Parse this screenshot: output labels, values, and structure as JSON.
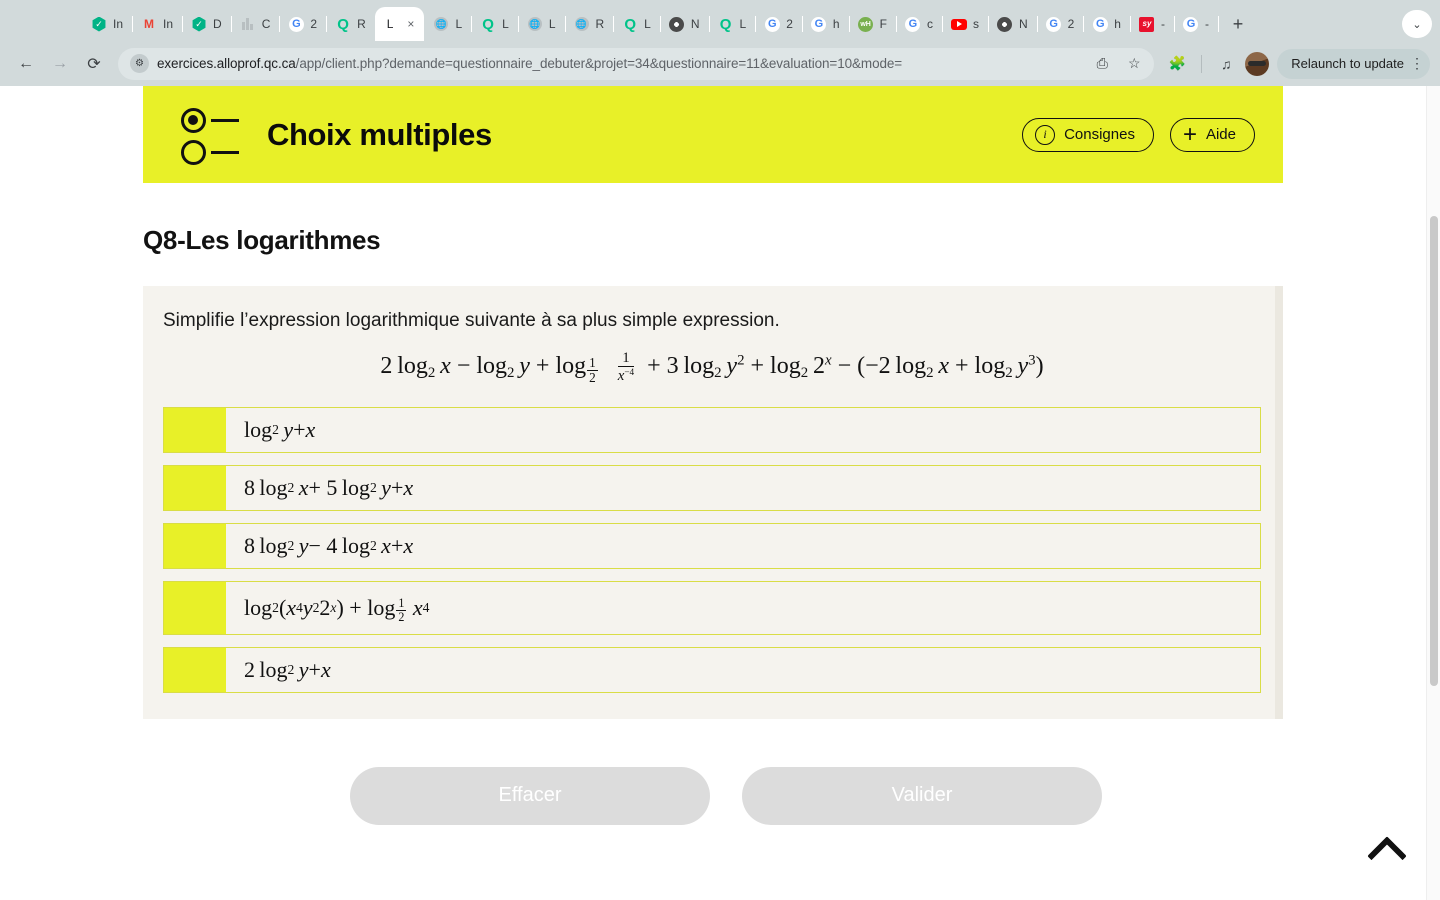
{
  "browser": {
    "tabs": [
      {
        "title": "In",
        "icon": "hexagon-green-icon",
        "active": false
      },
      {
        "title": "In",
        "icon": "gmail-icon",
        "active": false
      },
      {
        "title": "D",
        "icon": "hexagon-green-icon",
        "active": false
      },
      {
        "title": "C",
        "icon": "bars-grey-icon",
        "active": false
      },
      {
        "title": "2",
        "icon": "google-icon",
        "active": false
      },
      {
        "title": "R",
        "icon": "quizlet-icon",
        "active": false
      },
      {
        "title": "L",
        "icon": "alloprof-icon",
        "active": true
      },
      {
        "title": "L",
        "icon": "globe-grey-icon",
        "active": false
      },
      {
        "title": "L",
        "icon": "quizlet-icon",
        "active": false
      },
      {
        "title": "L",
        "icon": "globe-grey-icon",
        "active": false
      },
      {
        "title": "R",
        "icon": "globe-grey-icon",
        "active": false
      },
      {
        "title": "L",
        "icon": "quizlet-icon",
        "active": false
      },
      {
        "title": "N",
        "icon": "chrome-dark-icon",
        "active": false
      },
      {
        "title": "L",
        "icon": "quizlet-icon",
        "active": false
      },
      {
        "title": "2",
        "icon": "google-icon",
        "active": false
      },
      {
        "title": "h",
        "icon": "google-icon",
        "active": false
      },
      {
        "title": "F",
        "icon": "whatsapp-green-icon",
        "active": false
      },
      {
        "title": "c",
        "icon": "google-icon",
        "active": false
      },
      {
        "title": "s",
        "icon": "youtube-icon",
        "active": false
      },
      {
        "title": "N",
        "icon": "chrome-dark-icon",
        "active": false
      },
      {
        "title": "2",
        "icon": "google-icon",
        "active": false
      },
      {
        "title": "h",
        "icon": "google-icon",
        "active": false
      },
      {
        "title": "-",
        "icon": "sy-red-icon",
        "active": false
      },
      {
        "title": "-",
        "icon": "google-icon",
        "active": false
      }
    ],
    "new_tab_label": "+",
    "tab_close_label": "×",
    "tab_search_label": "⌄",
    "nav": {
      "back": "←",
      "forward": "→",
      "reload": "⟳"
    },
    "omnibox": {
      "site_info_icon": "site-settings-icon",
      "url_host": "exercices.alloprof.qc.ca",
      "url_path": "/app/client.php?demande=questionnaire_debuter&projet=34&questionnaire=11&evaluation=10&mode=",
      "translate_icon": "translate-icon",
      "bookmark_icon": "star-icon"
    },
    "extensions_icon": "extensions-puzzle-icon",
    "media_icon": "media-list-icon",
    "profile_icon": "profile-avatar",
    "relaunch_label": "Relaunch to update",
    "menu_icon": "kebab-menu-icon"
  },
  "banner": {
    "icon": "multiple-choice-icon",
    "title": "Choix multiples",
    "consignes_label": "Consignes",
    "consignes_icon": "info-circle-icon",
    "aide_label": "Aide",
    "aide_icon": "plus-icon",
    "background_color": "#e8f028"
  },
  "question": {
    "title": "Q8-Les logarithmes",
    "statement": "Simplifie l’expression logarithmique suivante à sa plus simple expression.",
    "expression_text": "2 log₂ x − log₂ y + log₁⁄₂ (1/x⁻⁴) + 3 log₂ y² + log₂ 2ˣ − (−2 log₂ x + log₂ y³)",
    "options": [
      {
        "id": "a",
        "text": "log₂ y + x"
      },
      {
        "id": "b",
        "text": "8 log₂ x + 5 log₂ y + x"
      },
      {
        "id": "c",
        "text": "8 log₂ y − 4 log₂ x + x"
      },
      {
        "id": "d",
        "text": "log₂(x⁴y²2ˣ) + log₁⁄₂ x⁴"
      },
      {
        "id": "e",
        "text": "2 log₂ y + x"
      }
    ],
    "selected": null
  },
  "actions": {
    "clear_label": "Effacer",
    "validate_label": "Valider"
  },
  "scroll_top": {
    "icon": "chevron-up-icon"
  }
}
